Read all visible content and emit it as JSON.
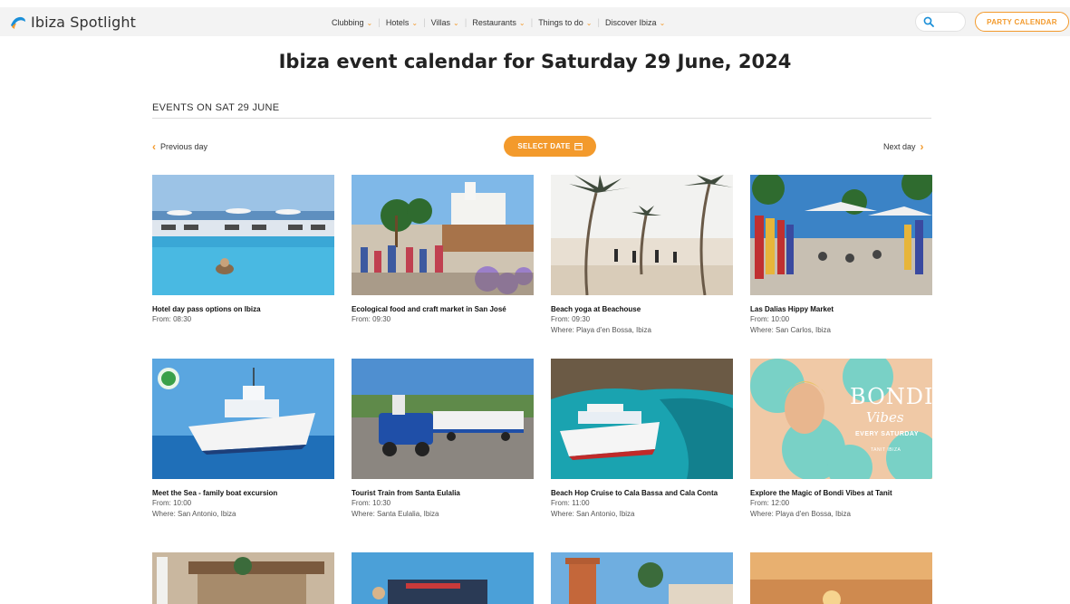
{
  "header": {
    "logo_text": "Ibiza Spotlight",
    "nav": [
      {
        "label": "Clubbing"
      },
      {
        "label": "Hotels"
      },
      {
        "label": "Villas"
      },
      {
        "label": "Restaurants"
      },
      {
        "label": "Things to do"
      },
      {
        "label": "Discover Ibiza"
      }
    ],
    "search_icon": "search-icon",
    "party_calendar_label": "PARTY CALENDAR"
  },
  "page": {
    "title": "Ibiza event calendar for Saturday 29 June, 2024",
    "section_label": "EVENTS ON SAT 29 JUNE",
    "prev_day": "Previous day",
    "next_day": "Next day",
    "select_date": "SELECT DATE"
  },
  "events": [
    {
      "title": "Hotel day pass options on Ibiza",
      "from": "From: 08:30",
      "where": ""
    },
    {
      "title": "Ecological food and craft market in San José",
      "from": "From: 09:30",
      "where": ""
    },
    {
      "title": "Beach yoga at Beachouse",
      "from": "From: 09:30",
      "where": "Where: Playa d'en Bossa, Ibiza"
    },
    {
      "title": "Las Dalias Hippy Market",
      "from": "From: 10:00",
      "where": "Where: San Carlos, Ibiza"
    },
    {
      "title": "Meet the Sea - family boat excursion",
      "from": "From: 10:00",
      "where": "Where: San Antonio, Ibiza"
    },
    {
      "title": "Tourist Train from Santa Eulalia",
      "from": "From: 10:30",
      "where": "Where: Santa Eulalia, Ibiza"
    },
    {
      "title": "Beach Hop Cruise to Cala Bassa and Cala Conta",
      "from": "From: 11:00",
      "where": "Where: San Antonio, Ibiza"
    },
    {
      "title": "Explore the Magic of Bondi Vibes at Tanit",
      "from": "From: 12:00",
      "where": "Where: Playa d'en Bossa, Ibiza"
    }
  ],
  "bondi_overlay": {
    "brand": "BONDI",
    "script": "Vibes",
    "day": "EVERY SATURDAY",
    "venue": "TANIT IBIZA"
  },
  "colors": {
    "accent": "#f39a2c"
  }
}
